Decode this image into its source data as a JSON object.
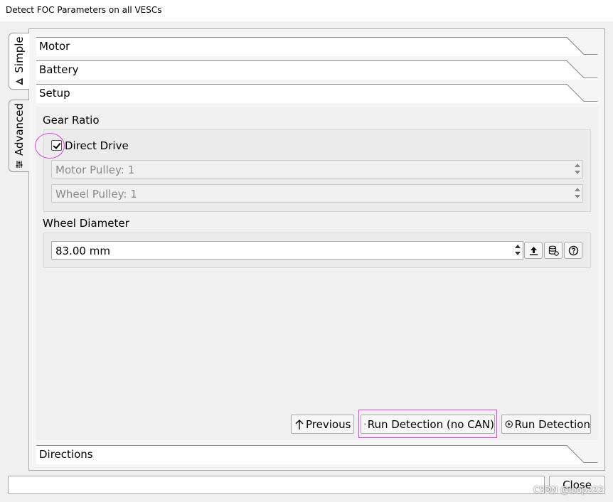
{
  "window": {
    "title": "Detect FOC Parameters on all VESCs"
  },
  "vertical_tabs": [
    {
      "label": "Simple",
      "icon": "simple-mode-icon",
      "active": true
    },
    {
      "label": "Advanced",
      "icon": "sliders-icon",
      "active": false
    }
  ],
  "sections": {
    "motor": "Motor",
    "battery": "Battery",
    "setup": "Setup",
    "directions": "Directions"
  },
  "setup": {
    "gear_ratio": {
      "label": "Gear Ratio",
      "direct_drive": {
        "label": "Direct Drive",
        "checked": true
      },
      "motor_pulley": "Motor Pulley: 1",
      "wheel_pulley": "Wheel Pulley: 1"
    },
    "wheel_diameter": {
      "label": "Wheel Diameter",
      "value": "83.00 mm",
      "tools": [
        "upload-icon",
        "database-gear-icon",
        "help-icon"
      ]
    }
  },
  "nav": {
    "previous": "Previous",
    "run_no_can": "Run Detection (no CAN)",
    "run": "Run Detection"
  },
  "footer": {
    "status": "",
    "close": "Close",
    "watermark": "CSDN @loop222"
  },
  "colors": {
    "annotation": "#e040e0",
    "panel": "#f0f0f0",
    "header_bg": "#ffffff",
    "border": "#a8a8a8"
  }
}
